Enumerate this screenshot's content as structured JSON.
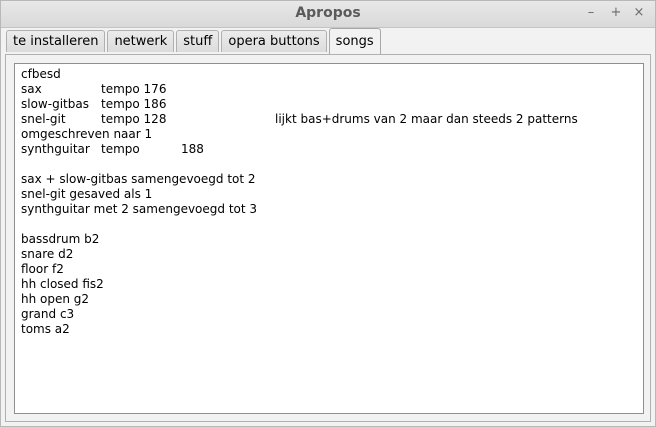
{
  "window": {
    "title": "Apropos",
    "controls": {
      "minimize": "–",
      "maximize": "+",
      "close": "×"
    }
  },
  "tabs": [
    {
      "label": "te installeren",
      "active": false
    },
    {
      "label": "netwerk",
      "active": false
    },
    {
      "label": "stuff",
      "active": false
    },
    {
      "label": "opera buttons",
      "active": false
    },
    {
      "label": "songs",
      "active": true
    }
  ],
  "songs_text": {
    "lines": [
      [
        "cfbesd"
      ],
      [
        "sax",
        "tempo 176"
      ],
      [
        "slow-gitbas",
        "tempo 186"
      ],
      [
        "snel-git",
        "tempo 128",
        "lijkt bas+drums van 2 maar dan steeds 2 patterns"
      ],
      [
        "omgeschreven naar 1"
      ],
      [
        "synthguitar",
        "tempo",
        "188"
      ],
      [
        ""
      ],
      [
        "sax + slow-gitbas samengevoegd tot 2"
      ],
      [
        "snel-git gesaved als 1"
      ],
      [
        "synthguitar met 2 samengevoegd tot 3"
      ],
      [
        ""
      ],
      [
        "bassdrum b2"
      ],
      [
        "snare d2"
      ],
      [
        "floor f2"
      ],
      [
        "hh closed fis2"
      ],
      [
        "hh open g2"
      ],
      [
        "grand c3"
      ],
      [
        "toms a2"
      ]
    ]
  }
}
